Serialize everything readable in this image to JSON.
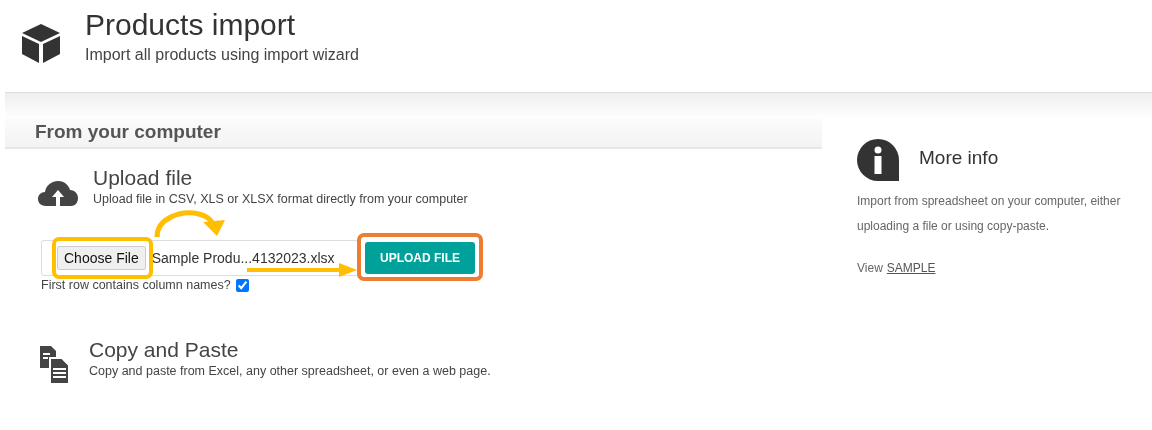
{
  "header": {
    "title": "Products import",
    "subtitle": "Import all products using import wizard"
  },
  "section": {
    "title": "From your computer"
  },
  "upload": {
    "title": "Upload file",
    "description": "Upload file in CSV, XLS or XLSX format directly from your computer",
    "choose_button": "Choose File",
    "file_name": "Sample Produ...4132023.xlsx",
    "submit_button": "UPLOAD FILE",
    "checkbox_label": "First row contains column names?",
    "checked": true
  },
  "copy": {
    "title": "Copy and Paste",
    "description": "Copy and paste from Excel, any other spreadsheet, or even a web page."
  },
  "info": {
    "title": "More info",
    "text": "Import from spreadsheet on your computer, either uploading a file or using copy-paste.",
    "view_label": "View",
    "link": "SAMPLE"
  }
}
